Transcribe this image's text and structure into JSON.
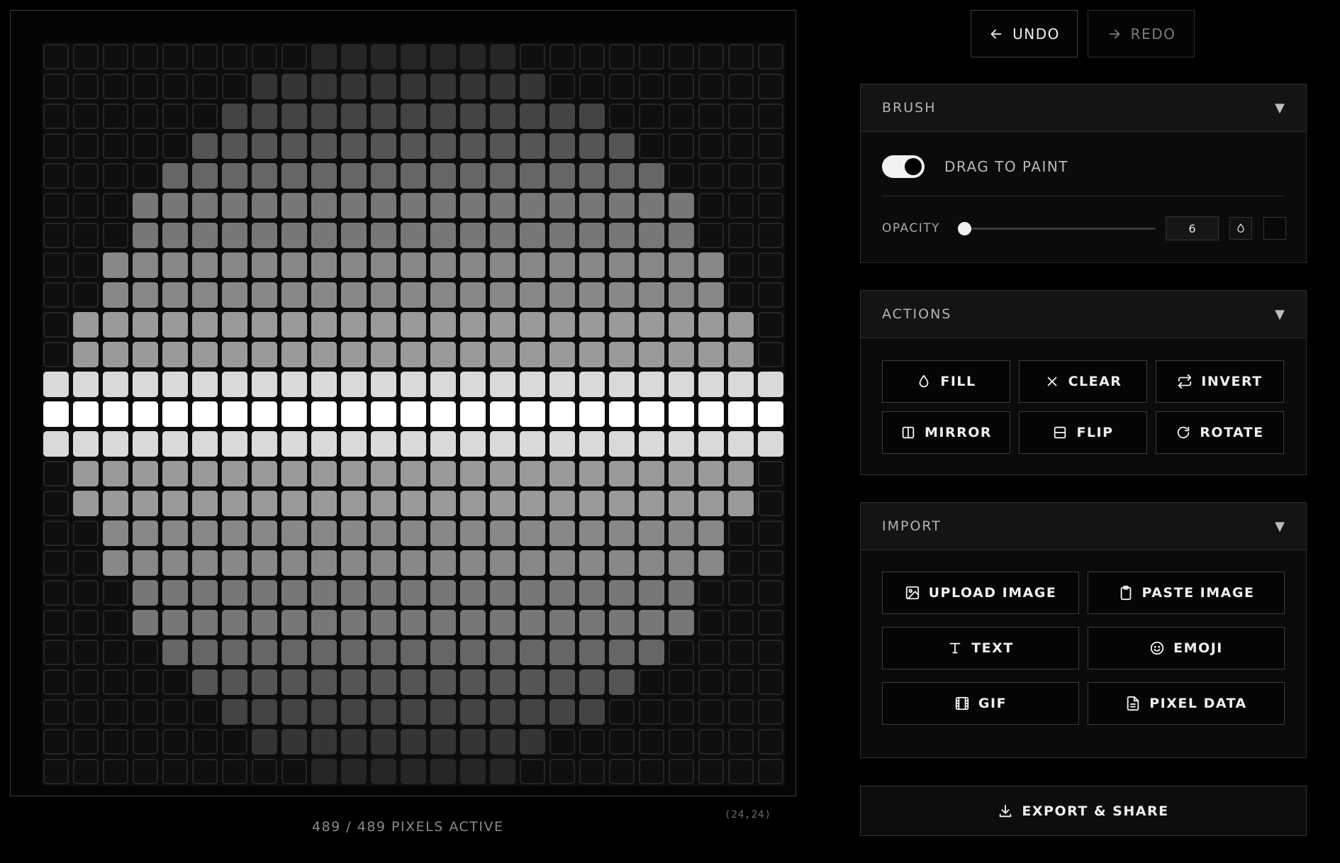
{
  "history": {
    "undo_label": "UNDO",
    "redo_label": "REDO"
  },
  "canvas": {
    "grid_size": 25,
    "pixel_count_text": "489 / 489 PIXELS ACTIVE",
    "coord_text": "(24,24)",
    "colors": [
      "#0f0f0f",
      "#1a1a1a",
      "#262626",
      "#353535",
      "#444444",
      "#555555",
      "#666666",
      "#777777",
      "#888888",
      "#9a9a9a",
      "#d9d9d9",
      "#ffffff"
    ],
    "rows": [
      "0000000001111111000000000",
      "0000000222222222200000000",
      "0000003333333333333000000",
      "0000044444444444444400000",
      "0000555555555555555550000",
      "0006666666666666666666000",
      "0006666666666666666666000",
      "0077777777777777777777700",
      "0077777777777777777777700",
      "0888888888888888888888880",
      "0888888888888888888888880",
      "9999999999999999999999999",
      "AAAAAAAAAAAAAAAAAAAAAAAAA",
      "9999999999999999999999999",
      "0888888888888888888888880",
      "0888888888888888888888880",
      "0077777777777777777777700",
      "0077777777777777777777700",
      "0006666666666666666666000",
      "0006666666666666666666000",
      "0000555555555555555550000",
      "0000044444444444444400000",
      "0000003333333333333000000",
      "0000000222222222200000000",
      "0000000001111111000000000"
    ]
  },
  "brush": {
    "title": "BRUSH",
    "toggle_label": "DRAG TO PAINT",
    "toggle_on": true,
    "opacity_label": "OPACITY",
    "opacity_value": "6",
    "opacity_fraction": 0.03
  },
  "actions": {
    "title": "ACTIONS",
    "items": [
      {
        "label": "FILL",
        "icon": "drop-icon"
      },
      {
        "label": "CLEAR",
        "icon": "x-icon"
      },
      {
        "label": "INVERT",
        "icon": "swap-icon"
      },
      {
        "label": "MIRROR",
        "icon": "mirror-icon"
      },
      {
        "label": "FLIP",
        "icon": "flip-icon"
      },
      {
        "label": "ROTATE",
        "icon": "rotate-icon"
      }
    ]
  },
  "import": {
    "title": "IMPORT",
    "items": [
      {
        "label": "UPLOAD IMAGE",
        "icon": "image-icon"
      },
      {
        "label": "PASTE IMAGE",
        "icon": "clipboard-icon"
      },
      {
        "label": "TEXT",
        "icon": "text-icon"
      },
      {
        "label": "EMOJI",
        "icon": "smile-icon"
      },
      {
        "label": "GIF",
        "icon": "film-icon"
      },
      {
        "label": "PIXEL DATA",
        "icon": "file-icon"
      }
    ]
  },
  "export": {
    "label": "EXPORT & SHARE",
    "icon": "download-icon"
  }
}
